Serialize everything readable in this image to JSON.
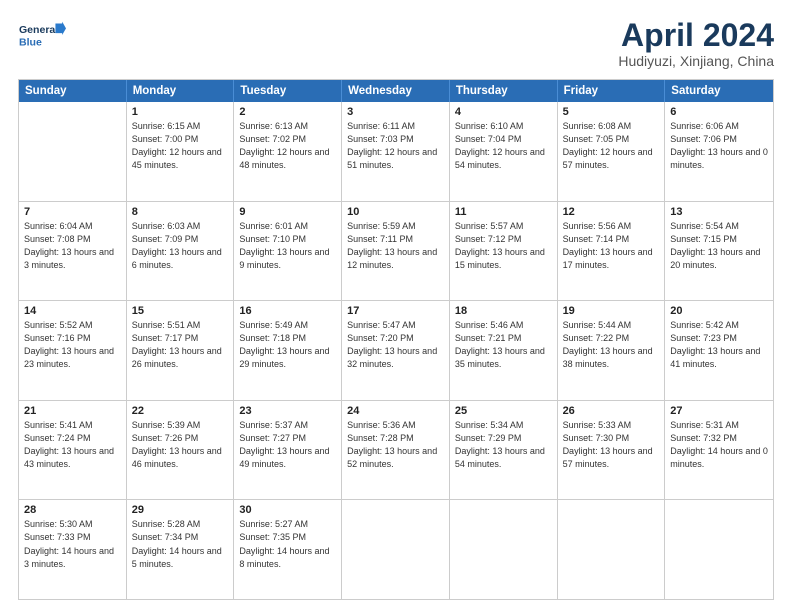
{
  "header": {
    "logo_line1": "General",
    "logo_line2": "Blue",
    "title": "April 2024",
    "subtitle": "Hudiyuzi, Xinjiang, China"
  },
  "days": [
    "Sunday",
    "Monday",
    "Tuesday",
    "Wednesday",
    "Thursday",
    "Friday",
    "Saturday"
  ],
  "weeks": [
    [
      {
        "day": "",
        "sunrise": "",
        "sunset": "",
        "daylight": ""
      },
      {
        "day": "1",
        "sunrise": "Sunrise: 6:15 AM",
        "sunset": "Sunset: 7:00 PM",
        "daylight": "Daylight: 12 hours and 45 minutes."
      },
      {
        "day": "2",
        "sunrise": "Sunrise: 6:13 AM",
        "sunset": "Sunset: 7:02 PM",
        "daylight": "Daylight: 12 hours and 48 minutes."
      },
      {
        "day": "3",
        "sunrise": "Sunrise: 6:11 AM",
        "sunset": "Sunset: 7:03 PM",
        "daylight": "Daylight: 12 hours and 51 minutes."
      },
      {
        "day": "4",
        "sunrise": "Sunrise: 6:10 AM",
        "sunset": "Sunset: 7:04 PM",
        "daylight": "Daylight: 12 hours and 54 minutes."
      },
      {
        "day": "5",
        "sunrise": "Sunrise: 6:08 AM",
        "sunset": "Sunset: 7:05 PM",
        "daylight": "Daylight: 12 hours and 57 minutes."
      },
      {
        "day": "6",
        "sunrise": "Sunrise: 6:06 AM",
        "sunset": "Sunset: 7:06 PM",
        "daylight": "Daylight: 13 hours and 0 minutes."
      }
    ],
    [
      {
        "day": "7",
        "sunrise": "Sunrise: 6:04 AM",
        "sunset": "Sunset: 7:08 PM",
        "daylight": "Daylight: 13 hours and 3 minutes."
      },
      {
        "day": "8",
        "sunrise": "Sunrise: 6:03 AM",
        "sunset": "Sunset: 7:09 PM",
        "daylight": "Daylight: 13 hours and 6 minutes."
      },
      {
        "day": "9",
        "sunrise": "Sunrise: 6:01 AM",
        "sunset": "Sunset: 7:10 PM",
        "daylight": "Daylight: 13 hours and 9 minutes."
      },
      {
        "day": "10",
        "sunrise": "Sunrise: 5:59 AM",
        "sunset": "Sunset: 7:11 PM",
        "daylight": "Daylight: 13 hours and 12 minutes."
      },
      {
        "day": "11",
        "sunrise": "Sunrise: 5:57 AM",
        "sunset": "Sunset: 7:12 PM",
        "daylight": "Daylight: 13 hours and 15 minutes."
      },
      {
        "day": "12",
        "sunrise": "Sunrise: 5:56 AM",
        "sunset": "Sunset: 7:14 PM",
        "daylight": "Daylight: 13 hours and 17 minutes."
      },
      {
        "day": "13",
        "sunrise": "Sunrise: 5:54 AM",
        "sunset": "Sunset: 7:15 PM",
        "daylight": "Daylight: 13 hours and 20 minutes."
      }
    ],
    [
      {
        "day": "14",
        "sunrise": "Sunrise: 5:52 AM",
        "sunset": "Sunset: 7:16 PM",
        "daylight": "Daylight: 13 hours and 23 minutes."
      },
      {
        "day": "15",
        "sunrise": "Sunrise: 5:51 AM",
        "sunset": "Sunset: 7:17 PM",
        "daylight": "Daylight: 13 hours and 26 minutes."
      },
      {
        "day": "16",
        "sunrise": "Sunrise: 5:49 AM",
        "sunset": "Sunset: 7:18 PM",
        "daylight": "Daylight: 13 hours and 29 minutes."
      },
      {
        "day": "17",
        "sunrise": "Sunrise: 5:47 AM",
        "sunset": "Sunset: 7:20 PM",
        "daylight": "Daylight: 13 hours and 32 minutes."
      },
      {
        "day": "18",
        "sunrise": "Sunrise: 5:46 AM",
        "sunset": "Sunset: 7:21 PM",
        "daylight": "Daylight: 13 hours and 35 minutes."
      },
      {
        "day": "19",
        "sunrise": "Sunrise: 5:44 AM",
        "sunset": "Sunset: 7:22 PM",
        "daylight": "Daylight: 13 hours and 38 minutes."
      },
      {
        "day": "20",
        "sunrise": "Sunrise: 5:42 AM",
        "sunset": "Sunset: 7:23 PM",
        "daylight": "Daylight: 13 hours and 41 minutes."
      }
    ],
    [
      {
        "day": "21",
        "sunrise": "Sunrise: 5:41 AM",
        "sunset": "Sunset: 7:24 PM",
        "daylight": "Daylight: 13 hours and 43 minutes."
      },
      {
        "day": "22",
        "sunrise": "Sunrise: 5:39 AM",
        "sunset": "Sunset: 7:26 PM",
        "daylight": "Daylight: 13 hours and 46 minutes."
      },
      {
        "day": "23",
        "sunrise": "Sunrise: 5:37 AM",
        "sunset": "Sunset: 7:27 PM",
        "daylight": "Daylight: 13 hours and 49 minutes."
      },
      {
        "day": "24",
        "sunrise": "Sunrise: 5:36 AM",
        "sunset": "Sunset: 7:28 PM",
        "daylight": "Daylight: 13 hours and 52 minutes."
      },
      {
        "day": "25",
        "sunrise": "Sunrise: 5:34 AM",
        "sunset": "Sunset: 7:29 PM",
        "daylight": "Daylight: 13 hours and 54 minutes."
      },
      {
        "day": "26",
        "sunrise": "Sunrise: 5:33 AM",
        "sunset": "Sunset: 7:30 PM",
        "daylight": "Daylight: 13 hours and 57 minutes."
      },
      {
        "day": "27",
        "sunrise": "Sunrise: 5:31 AM",
        "sunset": "Sunset: 7:32 PM",
        "daylight": "Daylight: 14 hours and 0 minutes."
      }
    ],
    [
      {
        "day": "28",
        "sunrise": "Sunrise: 5:30 AM",
        "sunset": "Sunset: 7:33 PM",
        "daylight": "Daylight: 14 hours and 3 minutes."
      },
      {
        "day": "29",
        "sunrise": "Sunrise: 5:28 AM",
        "sunset": "Sunset: 7:34 PM",
        "daylight": "Daylight: 14 hours and 5 minutes."
      },
      {
        "day": "30",
        "sunrise": "Sunrise: 5:27 AM",
        "sunset": "Sunset: 7:35 PM",
        "daylight": "Daylight: 14 hours and 8 minutes."
      },
      {
        "day": "",
        "sunrise": "",
        "sunset": "",
        "daylight": ""
      },
      {
        "day": "",
        "sunrise": "",
        "sunset": "",
        "daylight": ""
      },
      {
        "day": "",
        "sunrise": "",
        "sunset": "",
        "daylight": ""
      },
      {
        "day": "",
        "sunrise": "",
        "sunset": "",
        "daylight": ""
      }
    ]
  ]
}
